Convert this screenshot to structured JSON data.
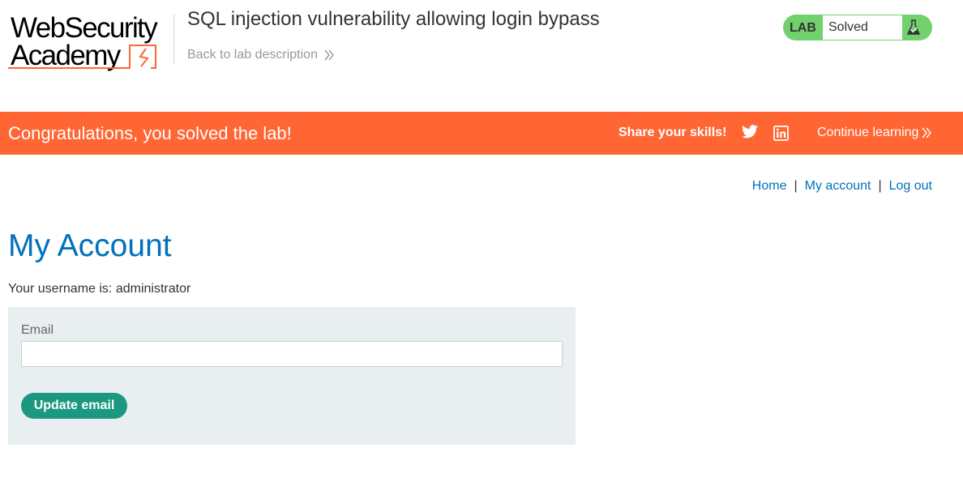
{
  "header": {
    "logo": {
      "line1": "WebSecurity",
      "line2": "Academy"
    },
    "lab_title": "SQL injection vulnerability allowing login bypass",
    "back_link": "Back to lab description",
    "lab_status": {
      "tag": "LAB",
      "status": "Solved"
    }
  },
  "banner": {
    "message": "Congratulations, you solved the lab!",
    "share_label": "Share your skills!",
    "continue_link": "Continue learning",
    "icons": [
      "twitter-icon",
      "linkedin-icon"
    ]
  },
  "nav": {
    "links": [
      {
        "label": "Home"
      },
      {
        "label": "My account"
      },
      {
        "label": "Log out"
      }
    ],
    "separator": "|"
  },
  "main": {
    "title": "My Account",
    "username_line": "Your username is: administrator",
    "form": {
      "email_label": "Email",
      "email_value": "",
      "email_placeholder": "",
      "submit_label": "Update email"
    }
  },
  "colors": {
    "banner": "#ff6633",
    "accent_blue": "#0071bc",
    "button_green": "#1a9980",
    "lab_green": "#70d16d",
    "form_bg": "#e9eef1"
  }
}
